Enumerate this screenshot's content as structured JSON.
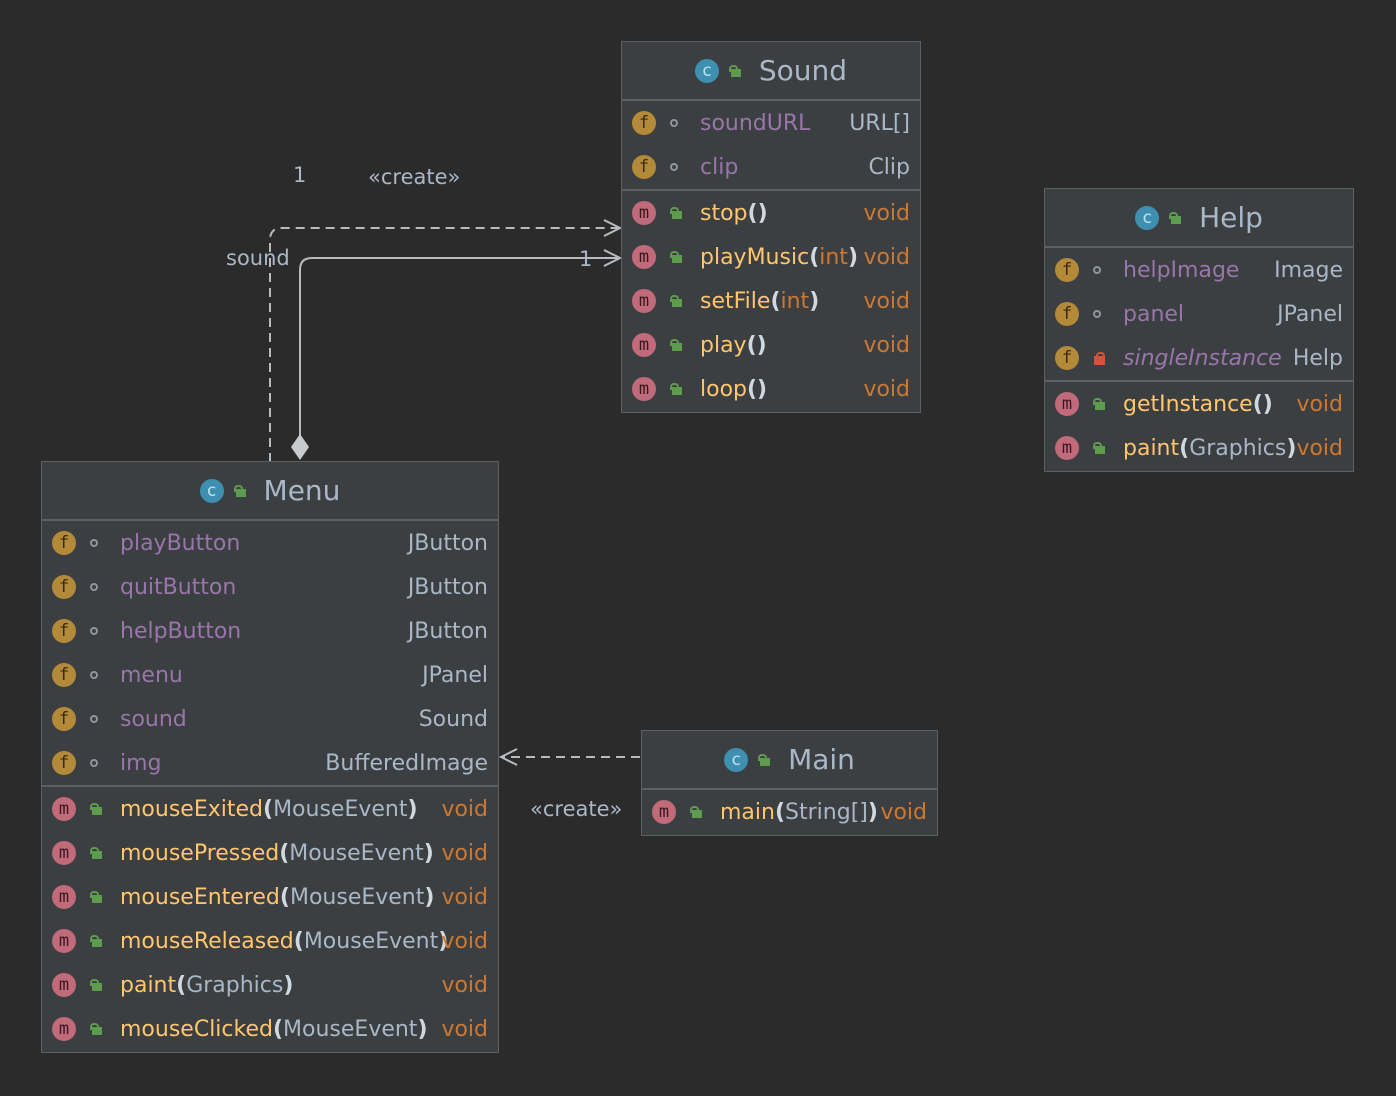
{
  "classes": {
    "sound": {
      "name": "Sound",
      "fields": [
        {
          "name": "soundURL",
          "type": "URL[]"
        },
        {
          "name": "clip",
          "type": "Clip"
        }
      ],
      "methods": [
        {
          "name": "stop",
          "params": "",
          "ret": "void"
        },
        {
          "name": "playMusic",
          "params": "int",
          "ret": "void"
        },
        {
          "name": "setFile",
          "params": "int",
          "ret": ""
        },
        {
          "name": "play",
          "params": "",
          "ret": "void"
        },
        {
          "name": "loop",
          "params": "",
          "ret": "void"
        }
      ],
      "setFile_ret": "void"
    },
    "help": {
      "name": "Help",
      "fields": [
        {
          "name": "helpImage",
          "type": "Image"
        },
        {
          "name": "panel",
          "type": "JPanel"
        },
        {
          "name": "singleInstance",
          "type": "Help"
        }
      ],
      "methods": [
        {
          "name": "getInstance",
          "params": "",
          "ret": "void"
        },
        {
          "name": "paint",
          "params": "Graphics",
          "ret": "void"
        }
      ]
    },
    "menu": {
      "name": "Menu",
      "fields": [
        {
          "name": "playButton",
          "type": "JButton"
        },
        {
          "name": "quitButton",
          "type": "JButton"
        },
        {
          "name": "helpButton",
          "type": "JButton"
        },
        {
          "name": "menu",
          "type": "JPanel"
        },
        {
          "name": "sound",
          "type": "Sound"
        },
        {
          "name": "img",
          "type": "BufferedImage"
        }
      ],
      "methods": [
        {
          "name": "mouseExited",
          "params": "MouseEvent",
          "ret": "void"
        },
        {
          "name": "mousePressed",
          "params": "MouseEvent",
          "ret": "void"
        },
        {
          "name": "mouseEntered",
          "params": "MouseEvent",
          "ret": "void"
        },
        {
          "name": "mouseReleased",
          "params": "MouseEvent",
          "ret": "void"
        },
        {
          "name": "paint",
          "params": "Graphics",
          "ret": "void"
        },
        {
          "name": "mouseClicked",
          "params": "MouseEvent",
          "ret": "void"
        }
      ]
    },
    "main": {
      "name": "Main",
      "methods": [
        {
          "name": "main",
          "params": "String[]",
          "ret": "void"
        }
      ]
    }
  },
  "edges": {
    "menu_sound_create": "«create»",
    "menu_sound_mult_src": "1",
    "menu_sound_mult_dst": "1",
    "menu_sound_role": "sound",
    "main_menu_create": "«create»"
  },
  "colors": {
    "background": "#2b2b2b",
    "box": "#3c3f41",
    "field": "#9876aa",
    "method": "#ffc66d",
    "keyword": "#cc7832",
    "text": "#a9b7c6"
  }
}
